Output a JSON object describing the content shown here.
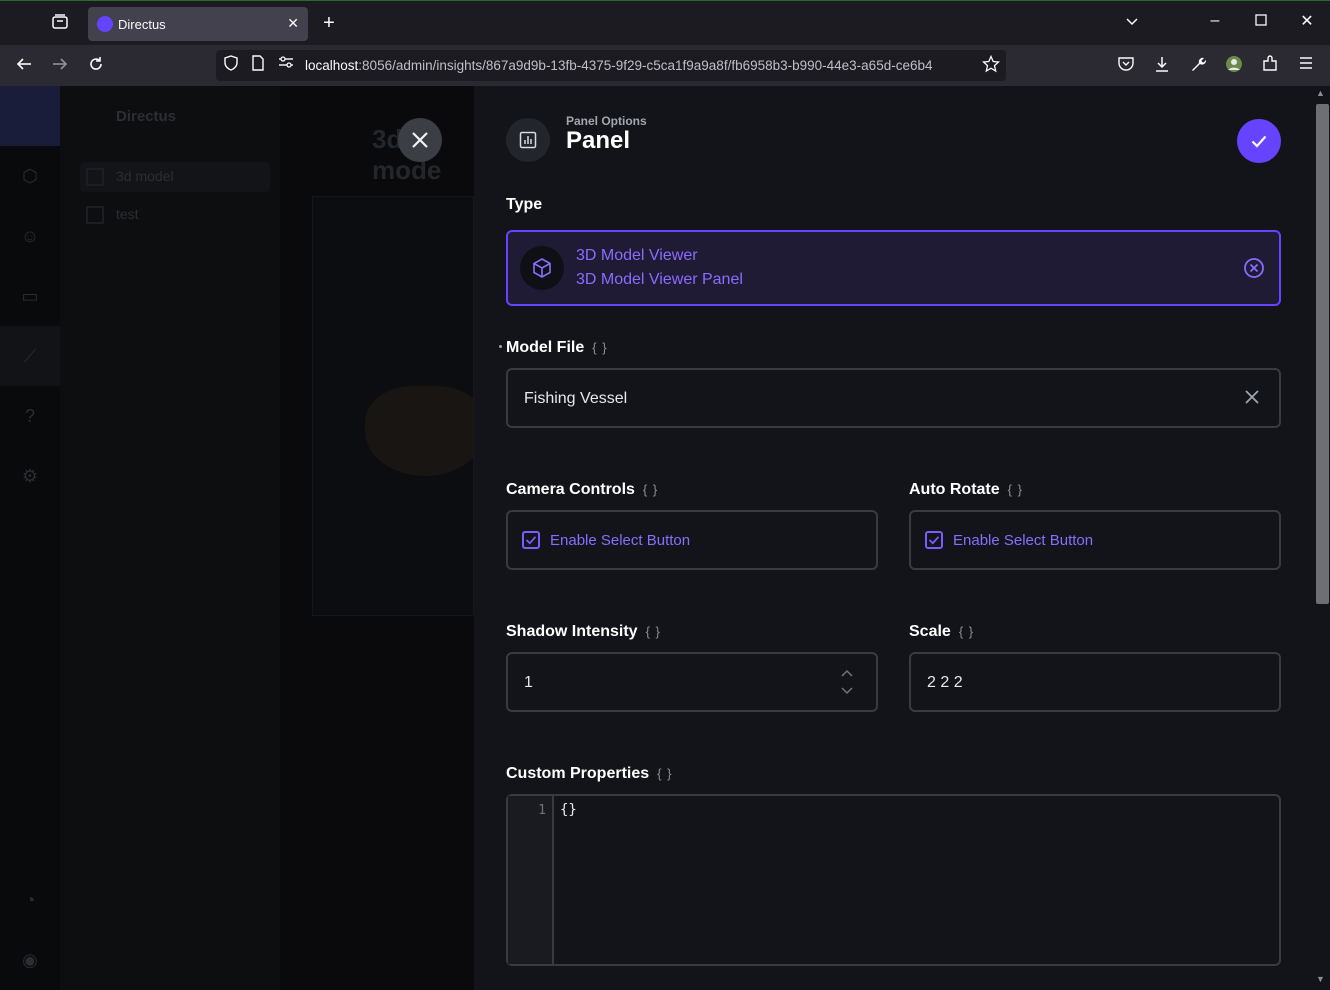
{
  "browser": {
    "tab_title": "Directus",
    "url_host": "localhost",
    "url_path": ":8056/admin/insights/867a9d9b-13fb-4375-9f29-c5ca1f9a9a8f/fb6958b3-b990-44e3-a65d-ce6b4"
  },
  "app_bg": {
    "nav_header": "Directus",
    "nav_items": [
      {
        "label": "3d model"
      },
      {
        "label": "test"
      }
    ],
    "page_title": "3d mode"
  },
  "drawer": {
    "subtitle": "Panel Options",
    "title": "Panel",
    "type_section": {
      "label": "Type",
      "selected_name": "3D Model Viewer",
      "selected_desc": "3D Model Viewer Panel"
    },
    "model_file": {
      "label": "Model File",
      "value": "Fishing Vessel"
    },
    "camera_controls": {
      "label": "Camera Controls",
      "checkbox_label": "Enable Select Button",
      "checked": true
    },
    "auto_rotate": {
      "label": "Auto Rotate",
      "checkbox_label": "Enable Select Button",
      "checked": true
    },
    "shadow_intensity": {
      "label": "Shadow Intensity",
      "value": "1"
    },
    "scale": {
      "label": "Scale",
      "value": "2 2 2"
    },
    "custom_properties": {
      "label": "Custom Properties",
      "line_number": "1",
      "code": "{}"
    },
    "braces_glyph": "{ }"
  },
  "colors": {
    "accent": "#6644ff",
    "background": "#12141a",
    "border": "#383b42"
  }
}
